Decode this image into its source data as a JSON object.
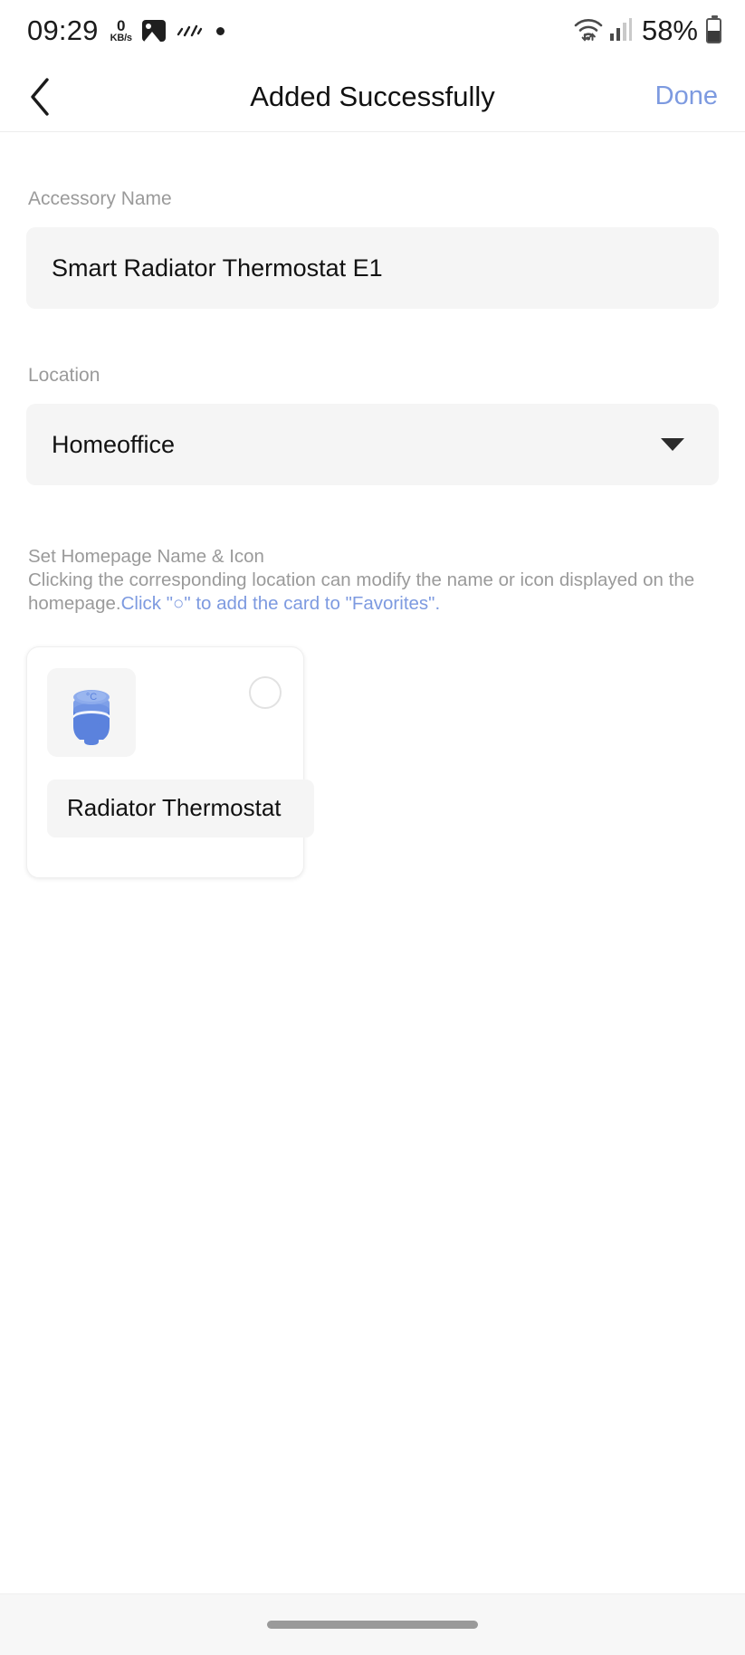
{
  "status_bar": {
    "time": "09:29",
    "net_speed_value": "0",
    "net_speed_unit": "KB/s",
    "icons": [
      "image-icon",
      "scribble-icon",
      "dot-icon",
      "wifi-icon",
      "cellular-signal-icon",
      "battery-icon"
    ],
    "battery_percent": "58%"
  },
  "nav": {
    "back_icon": "chevron-left-icon",
    "title": "Added Successfully",
    "done_label": "Done",
    "accent_color": "#7d9ae0"
  },
  "form": {
    "accessory_name_label": "Accessory Name",
    "accessory_name_value": "Smart Radiator Thermostat E1",
    "accessory_name_placeholder": "Accessory Name",
    "location_label": "Location",
    "location_value": "Homeoffice",
    "location_caret_icon": "chevron-down-icon"
  },
  "homepage_section": {
    "heading": "Set Homepage Name & Icon",
    "description": "Clicking the corresponding location can modify the name or icon displayed on the homepage.",
    "link_text": "Click \"○\" to add the card to \"Favorites\".",
    "card": {
      "device_icon": "radiator-thermostat-icon",
      "device_icon_label": "°C",
      "favorite_icon": "circle-outline-icon",
      "favorite_selected": false,
      "name_value": "Radiator Thermostat",
      "name_placeholder": "Radiator Thermostat"
    }
  },
  "system_nav": {
    "gesture_bar": "home-gesture-bar"
  }
}
